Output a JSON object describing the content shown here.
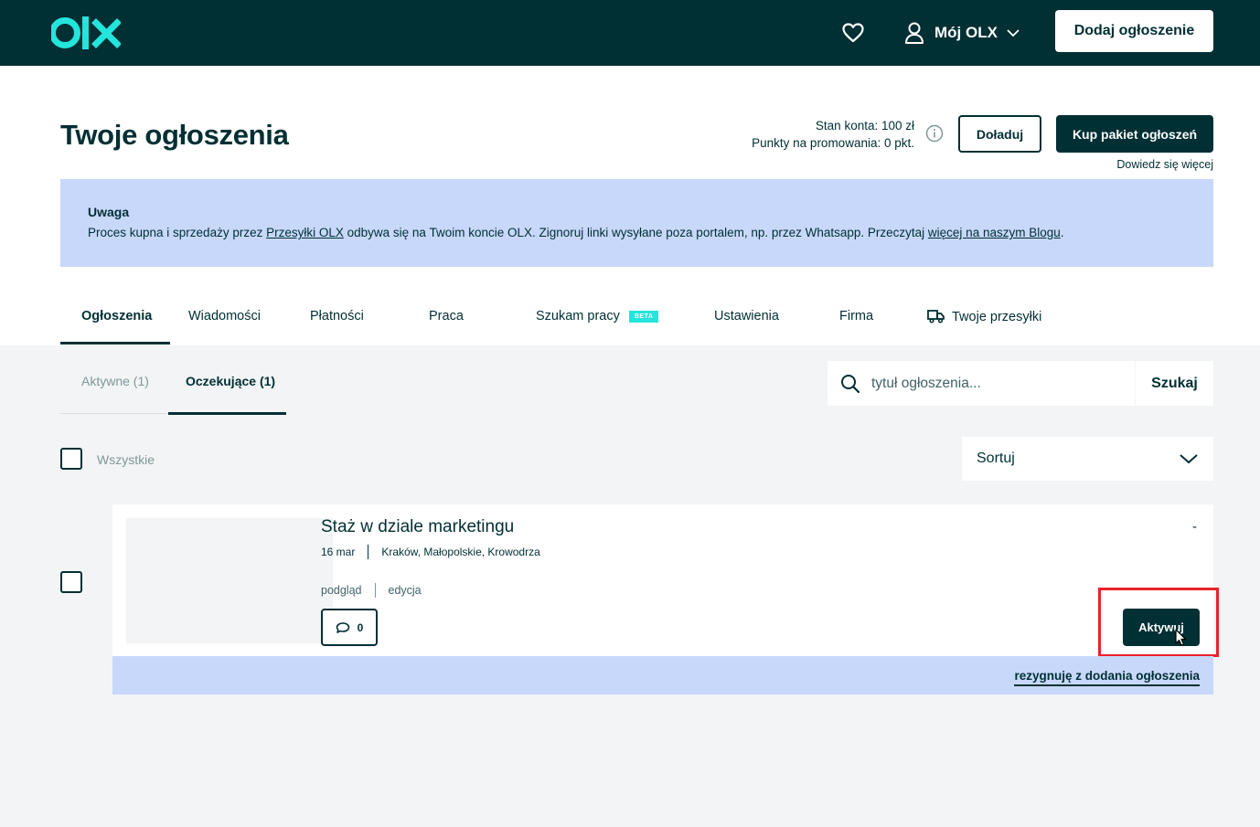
{
  "header": {
    "logo_text": "olx",
    "my_olx_label": "Mój OLX",
    "add_ad_label": "Dodaj ogłoszenie"
  },
  "page": {
    "title": "Twoje ogłoszenia",
    "balance_line1": "Stan konta: 100 zł",
    "balance_line2": "Punkty na promowania: 0 pkt.",
    "topup_label": "Doładuj",
    "buy_package_label": "Kup pakiet ogłoszeń",
    "learn_more": "Dowiedz się więcej"
  },
  "notice": {
    "title": "Uwaga",
    "text_1": "Proces kupna i sprzedaży przez ",
    "link_1": "Przesyłki OLX",
    "text_2": " odbywa się na Twoim koncie OLX. Zignoruj linki wysyłane poza portalem, np. przez Whatsapp. Przeczytaj ",
    "link_2": "więcej na naszym Blogu",
    "text_3": "."
  },
  "tabs": [
    {
      "label": "Ogłoszenia"
    },
    {
      "label": "Wiadomości"
    },
    {
      "label": "Płatności"
    },
    {
      "label": "Praca"
    },
    {
      "label": "Szukam pracy",
      "badge": "BETA"
    },
    {
      "label": "Ustawienia"
    },
    {
      "label": "Firma"
    },
    {
      "label": "Twoje przesyłki"
    }
  ],
  "subtabs": [
    {
      "label": "Aktywne (1)"
    },
    {
      "label": "Oczekujące (1)"
    }
  ],
  "search": {
    "placeholder": "tytuł ogłoszenia...",
    "button_label": "Szukaj"
  },
  "select_all_label": "Wszystkie",
  "sort_label": "Sortuj",
  "ad": {
    "title": "Staż w dziale marketingu",
    "date": "16 mar",
    "location": "Kraków, Małopolskie, Krowodrza",
    "preview_link": "podgląd",
    "edit_link": "edycja",
    "messages_count": "0",
    "status_dash": "-",
    "activate_label": "Aktywuj",
    "resign_label": "rezygnuję z dodania ogłoszenia"
  },
  "colors": {
    "brand_dark": "#002f34",
    "brand_teal": "#23e5db",
    "notice_bg": "#c8d8fa",
    "highlight_red": "#e8232a"
  }
}
